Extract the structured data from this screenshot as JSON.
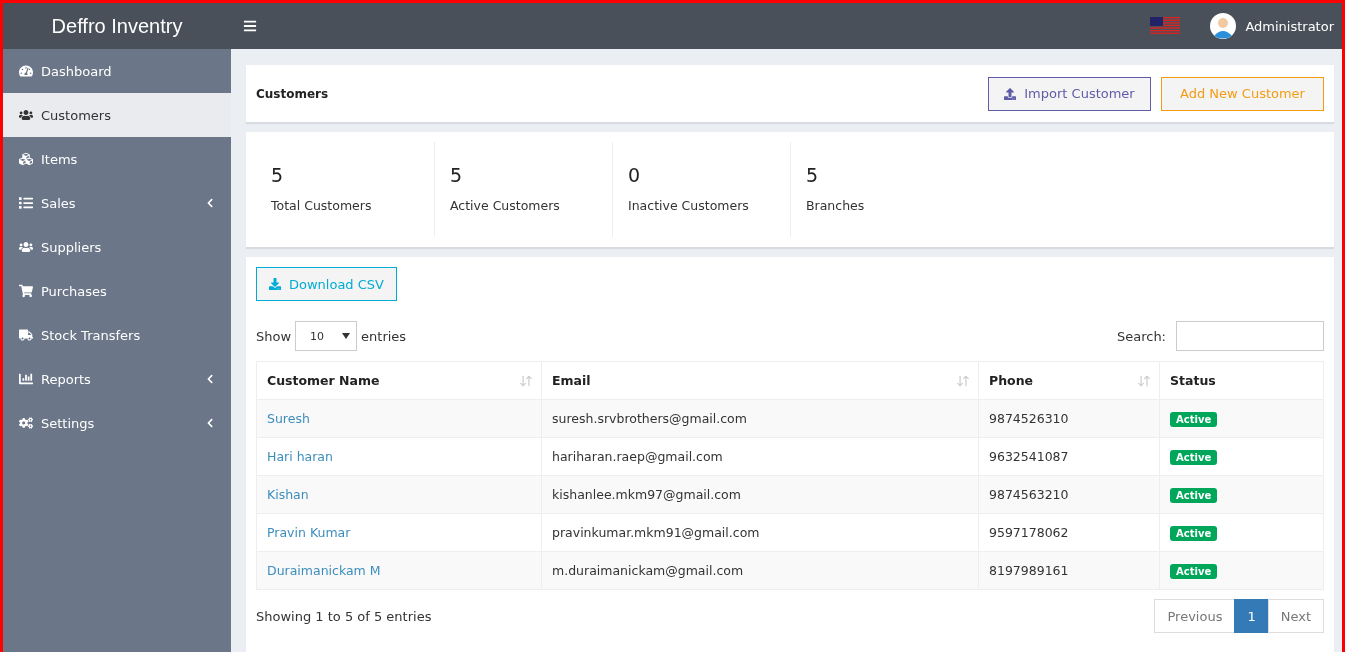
{
  "header": {
    "brand": "Deffro Inventry",
    "user": "Administrator"
  },
  "sidebar": {
    "items": [
      {
        "label": "Dashboard",
        "kind": "dashboard",
        "selected": false,
        "expandable": false
      },
      {
        "label": "Customers",
        "kind": "users",
        "selected": true,
        "expandable": false
      },
      {
        "label": "Items",
        "kind": "cubes",
        "selected": false,
        "expandable": false
      },
      {
        "label": "Sales",
        "kind": "list",
        "selected": false,
        "expandable": true
      },
      {
        "label": "Suppliers",
        "kind": "users",
        "selected": false,
        "expandable": false
      },
      {
        "label": "Purchases",
        "kind": "cart",
        "selected": false,
        "expandable": false
      },
      {
        "label": "Stock Transfers",
        "kind": "truck",
        "selected": false,
        "expandable": false
      },
      {
        "label": "Reports",
        "kind": "chart",
        "selected": false,
        "expandable": true
      },
      {
        "label": "Settings",
        "kind": "cogs",
        "selected": false,
        "expandable": true
      }
    ]
  },
  "page": {
    "title": "Customers",
    "buttons": [
      {
        "label": "Import Customer",
        "kind": "import"
      },
      {
        "label": "Add New Customer",
        "kind": "add"
      }
    ]
  },
  "stats": [
    {
      "value": "5",
      "label": "Total Customers"
    },
    {
      "value": "5",
      "label": "Active Customers"
    },
    {
      "value": "0",
      "label": "Inactive Customers"
    },
    {
      "value": "5",
      "label": "Branches"
    }
  ],
  "table_panel": {
    "download": "Download CSV",
    "show_label": "Show",
    "page_size": "10",
    "entries_label": "entries",
    "search_label": "Search:",
    "columns": [
      {
        "label": "Customer Name",
        "sortable": true
      },
      {
        "label": "Email",
        "sortable": true
      },
      {
        "label": "Phone",
        "sortable": true
      },
      {
        "label": "Status",
        "sortable": false
      }
    ],
    "rows": [
      {
        "name": "Suresh",
        "email": "suresh.srvbrothers@gmail.com",
        "phone": "9874526310",
        "status": "Active"
      },
      {
        "name": "Hari haran",
        "email": "hariharan.raep@gmail.com",
        "phone": "9632541087",
        "status": "Active"
      },
      {
        "name": "Kishan",
        "email": "kishanlee.mkm97@gmail.com",
        "phone": "9874563210",
        "status": "Active"
      },
      {
        "name": "Pravin Kumar",
        "email": "pravinkumar.mkm91@gmail.com",
        "phone": "9597178062",
        "status": "Active"
      },
      {
        "name": "Duraimanickam M",
        "email": "m.duraimanickam@gmail.com",
        "phone": "8197989161",
        "status": "Active"
      }
    ],
    "info": "Showing 1 to 5 of 5 entries",
    "pagination": [
      {
        "label": "Previous",
        "selected": false
      },
      {
        "label": "1",
        "selected": true
      },
      {
        "label": "Next",
        "selected": false
      }
    ]
  }
}
